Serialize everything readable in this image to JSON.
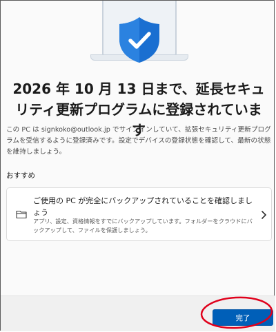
{
  "page": {
    "title": "2026 年 10 月 13 日まで、延長セキュリティ更新プログラムに登録されています",
    "description": "この PC は signkoko@outlook.jp でサインインしていて、拡張セキュリティ更新プログラムを受信するように登録済みです。設定でデバイスの登録状態を確認して、最新の状態を維持しましょう。",
    "recommended_label": "おすすめ"
  },
  "card": {
    "icon": "folder-icon",
    "title": "ご使用の PC が完全にバックアップされていることを確認しましょう",
    "description": "アプリ、設定、資格情報をすでにバックアップしています。フォルダーをクラウドにバックアップして、ファイルを保護しましょう。",
    "chevron_icon": "chevron-right-icon"
  },
  "footer": {
    "done_label": "完了"
  },
  "colors": {
    "accent": "#005fb8",
    "shield": "#1a6fd1",
    "annotation": "#e0001b"
  },
  "hero": {
    "icons": [
      "laptop-icon",
      "shield-check-icon"
    ]
  }
}
